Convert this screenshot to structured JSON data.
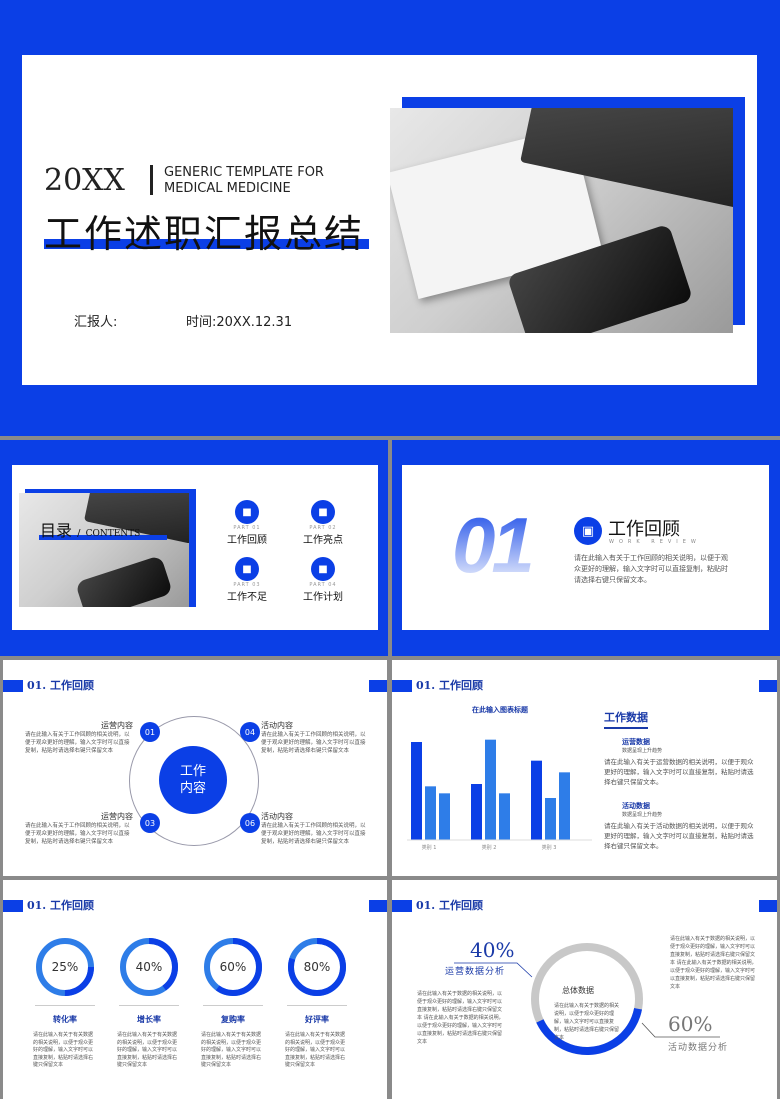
{
  "colors": {
    "primary": "#0b3fe6",
    "secondary": "#2e7de8",
    "gray": "#c8c8c8"
  },
  "cover": {
    "year": "20XX",
    "subtitle_line1": "GENERIC TEMPLATE FOR",
    "subtitle_line2": "MEDICAL MEDICINE",
    "title": "工作述职汇报总结",
    "reporter_label": "汇报人:",
    "time_label": "时间:",
    "time_value": "20XX.12.31"
  },
  "contents": {
    "title": "目录",
    "separator": "/",
    "title_en": "CONTENTS",
    "items": [
      {
        "part": "PART 01",
        "label": "工作回顾",
        "icon": "briefcase-icon"
      },
      {
        "part": "PART 02",
        "label": "工作亮点",
        "icon": "calendar-icon"
      },
      {
        "part": "PART 03",
        "label": "工作不足",
        "icon": "team-icon"
      },
      {
        "part": "PART 04",
        "label": "工作计划",
        "icon": "handshake-icon"
      }
    ]
  },
  "section": {
    "number": "01",
    "title": "工作回顾",
    "title_en": "WORK REVIEW",
    "desc": "请在此输入有关于工作回顾的相关说明，以便于观众更好的理解，输入文字时可以直接复制，粘贴时请选择右键只保留文本。"
  },
  "header": "01. 工作回顾",
  "cycle": {
    "center_line1": "工作",
    "center_line2": "内容",
    "items": [
      {
        "num": "01",
        "title": "运营内容",
        "desc": "请在此输入有关于工作回顾的相关说明，以便于观众更好的理解，输入文字时可以直接复制，粘贴时请选择右键只保留文本"
      },
      {
        "num": "04",
        "title": "活动内容",
        "desc": "请在此输入有关于工作回顾的相关说明，以便于观众更好的理解，输入文字时可以直接复制，粘贴时请选择右键只保留文本"
      },
      {
        "num": "03",
        "title": "运营内容",
        "desc": "请在此输入有关于工作回顾的相关说明，以便于观众更好的理解，输入文字时可以直接复制，粘贴时请选择右键只保留文本"
      },
      {
        "num": "06",
        "title": "活动内容",
        "desc": "请在此输入有关于工作回顾的相关说明，以便于观众更好的理解，输入文字时可以直接复制，粘贴时请选择右键只保留文本"
      }
    ]
  },
  "chart_data": {
    "type": "bar",
    "title": "在此输入图表标题",
    "categories": [
      "类别 1",
      "类别 2",
      "类别 3"
    ],
    "series": [
      {
        "values": [
          4.2,
          2.4,
          3.4
        ],
        "color": "#0b3fe6"
      },
      {
        "values": [
          2.3,
          4.3,
          1.8
        ],
        "color": "#2e7de8"
      },
      {
        "values": [
          2.0,
          2.0,
          2.9
        ],
        "color": "#2e7de8"
      }
    ],
    "ylim": [
      0,
      4.5
    ],
    "grid": false
  },
  "work_data": {
    "title": "工作数据",
    "blocks": [
      {
        "title": "运营数据",
        "sub": "数据呈现上升趋势",
        "desc": "请在此输入有关于运营数据的相关说明，以便于观众更好的理解，输入文字时可以直接复制，粘贴时请选择右键只保留文本。"
      },
      {
        "title": "活动数据",
        "sub": "数据呈现上升趋势",
        "desc": "请在此输入有关于活动数据的相关说明，以便于观众更好的理解，输入文字时可以直接复制，粘贴时请选择右键只保留文本。"
      }
    ]
  },
  "rates": [
    {
      "value": 25,
      "label": "25%",
      "name": "转化率",
      "desc": "请在此输入有关于有关数据的相关说明，以便于观众更好的理解，输入文字时可以直接复制，粘贴时请选择右键只保留文本"
    },
    {
      "value": 40,
      "label": "40%",
      "name": "增长率",
      "desc": "请在此输入有关于有关数据的相关说明，以便于观众更好的理解，输入文字时可以直接复制，粘贴时请选择右键只保留文本"
    },
    {
      "value": 60,
      "label": "60%",
      "name": "复购率",
      "desc": "请在此输入有关于有关数据的相关说明，以便于观众更好的理解，输入文字时可以直接复制，粘贴时请选择右键只保留文本"
    },
    {
      "value": 80,
      "label": "80%",
      "name": "好评率",
      "desc": "请在此输入有关于有关数据的相关说明，以便于观众更好的理解，输入文字时可以直接复制，粘贴时请选择右键只保留文本"
    }
  ],
  "overall": {
    "title": "总体数据",
    "center_desc": "请在此输入有关于数据的相关说明，以便于观众更好的理解，输入文字时可以直接复制，粘贴时请选择右键只保留文本",
    "left_pct": "40%",
    "left_label": "运营数据分析",
    "right_pct": "60%",
    "right_label": "活动数据分析",
    "value": 40,
    "left_desc": "请在此输入有关于数据的相关说明，以便于观众更好的理解，输入文字时可以直接复制，粘贴时请选择右键只保留文本 请在此输入有关于数据的相关说明，以便于观众更好的理解，输入文字时可以直接复制，粘贴时请选择右键只保留文本",
    "right_desc": "请在此输入有关于数据的相关说明，以便于观众更好的理解，输入文字时可以直接复制，粘贴时请选择右键只保留文本 请在此输入有关于数据的相关说明，以便于观众更好的理解，输入文字时可以直接复制，粘贴时请选择右键只保留文本"
  }
}
